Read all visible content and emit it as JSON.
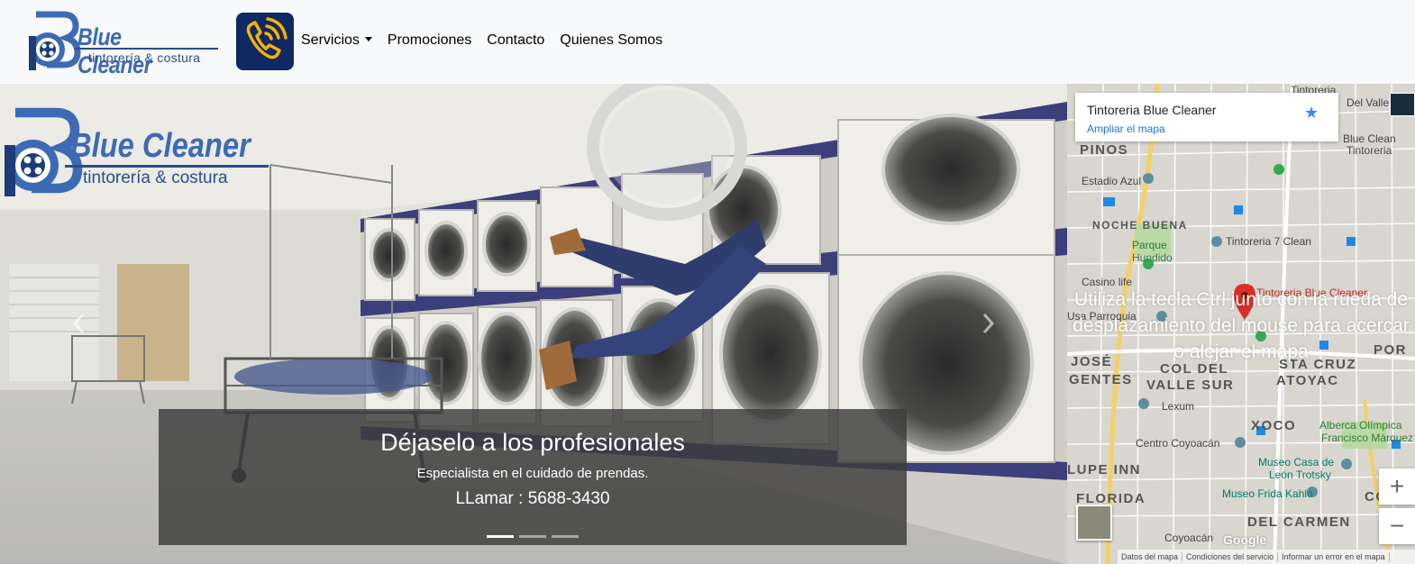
{
  "brand": {
    "name": "Blue Cleaner",
    "tagline": "tintorería & costura"
  },
  "nav": {
    "items": [
      {
        "label": "Servicios",
        "dropdown": true
      },
      {
        "label": "Promociones"
      },
      {
        "label": "Contacto"
      },
      {
        "label": "Quienes Somos"
      }
    ]
  },
  "carousel": {
    "overlay_brand": "Blue Cleaner",
    "overlay_tagline": "tintorería & costura",
    "caption_title": "Déjaselo a los profesionales",
    "caption_text": "Especialista en el cuidado de prendas.",
    "caption_phone": "LLamar : 5688-3430",
    "slides": 3,
    "active_slide": 1
  },
  "map": {
    "place_title": "Tintoreria Blue Cleaner",
    "enlarge_link": "Ampliar el mapa",
    "overlay_hint": "Utiliza la tecla Ctrl junto con la rueda de desplazamiento del mouse para acercar o alejar el mapa",
    "pin_label": "Tintoreria Blue Cleaner",
    "footer": [
      "Datos del mapa",
      "Condiciones del servicio",
      "Informar un error en el mapa"
    ],
    "zoom_in": "+",
    "zoom_out": "−",
    "google": "Google",
    "labels": {
      "tintoreria_top": "Tintoreria",
      "del_valle": "Del Valle",
      "blue_clean": "Blue Clean",
      "tintoreria2": "Tintoreria",
      "pinos": "PINOS",
      "estadio": "Estadio Azul",
      "noche_buena": "NOCHE BUENA",
      "parque1": "Parque",
      "parque2": "Hundido",
      "tint7": "Tintoreria 7 Clean",
      "casino": "Casino life",
      "parroquia": "Usa Parroquia",
      "jose": "JOSÉ",
      "col_del": "COL DEL",
      "sta_cruz": "STA CRUZ",
      "gentes": "GENTES",
      "valle_sur": "VALLE SUR",
      "atoyac": "ATOYAC",
      "lexum": "Lexum",
      "xoco": "XOCO",
      "alberca1": "Alberca Olímpica",
      "alberca2": "Francisco Márquez",
      "centro": "Centro Coyoacán",
      "museo_casa1": "Museo Casa de",
      "museo_casa2": "León Trotsky",
      "lupe": "LUPE INN",
      "frida": "Museo Frida Kahlo",
      "florida": "FLORIDA",
      "carmen": "DEL CARMEN",
      "coyoacan": "Coyoacán",
      "por": "POR",
      "co": "CO"
    }
  },
  "colors": {
    "brand_blue": "#3d6ab4",
    "navy": "#102864",
    "phone_yellow": "#f5b400",
    "map_link": "#1a73e8"
  }
}
